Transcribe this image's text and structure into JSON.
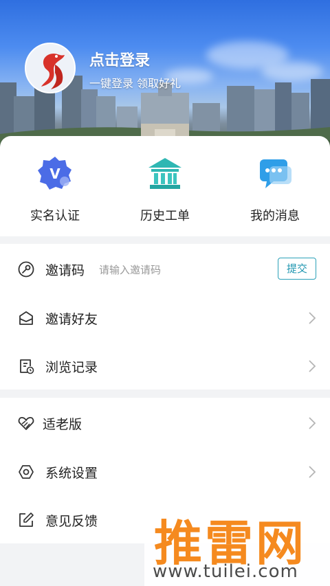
{
  "header": {
    "login_title": "点击登录",
    "login_subtitle": "一键登录 领取好礼"
  },
  "quick_actions": [
    {
      "label": "实名认证",
      "icon": "verified-badge-icon"
    },
    {
      "label": "历史工单",
      "icon": "building-icon"
    },
    {
      "label": "我的消息",
      "icon": "message-icon"
    }
  ],
  "invite_code": {
    "label": "邀请码",
    "placeholder": "请输入邀请码",
    "submit_label": "提交",
    "icon": "key-icon"
  },
  "menu_group_1": [
    {
      "label": "邀请好友",
      "icon": "envelope-icon"
    },
    {
      "label": "浏览记录",
      "icon": "history-icon"
    }
  ],
  "menu_group_2": [
    {
      "label": "适老版",
      "icon": "heart-hands-icon"
    },
    {
      "label": "系统设置",
      "icon": "settings-icon"
    },
    {
      "label": "意见反馈",
      "icon": "edit-icon"
    }
  ],
  "watermark": {
    "brand": "推雷网",
    "url": "www.tuilei.com"
  },
  "colors": {
    "accent": "#2aa0b8",
    "watermark": "#f58a1f"
  }
}
